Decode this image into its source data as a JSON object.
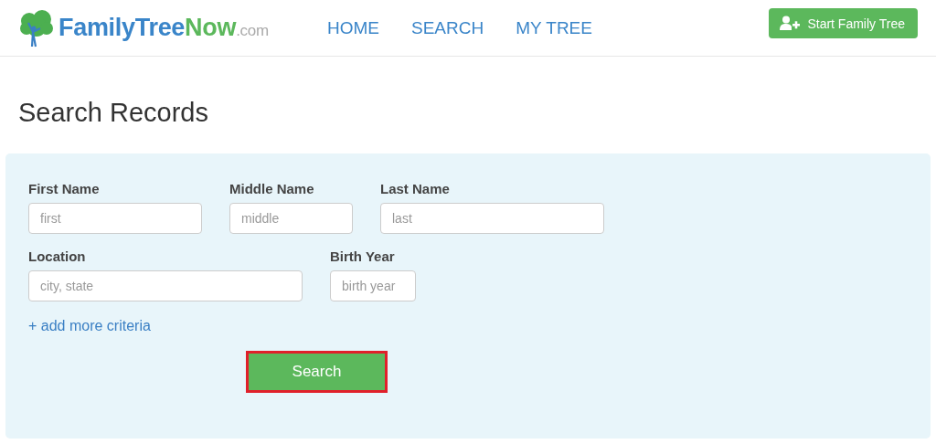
{
  "header": {
    "logo": {
      "name_part_1": "FamilyTree",
      "name_part_2": "Now",
      "domain": ".com"
    },
    "nav": [
      {
        "label": "HOME"
      },
      {
        "label": "SEARCH"
      },
      {
        "label": "MY TREE"
      }
    ],
    "action_button": {
      "label": "Start Family Tree"
    }
  },
  "page_title": "Search Records",
  "search_form": {
    "rows": [
      [
        {
          "label": "First Name",
          "placeholder": "first"
        },
        {
          "label": "Middle Name",
          "placeholder": "middle"
        },
        {
          "label": "Last Name",
          "placeholder": "last"
        }
      ],
      [
        {
          "label": "Location",
          "placeholder": "city, state"
        },
        {
          "label": "Birth Year",
          "placeholder": "birth year"
        }
      ]
    ],
    "more_link": "+ add more criteria",
    "submit": {
      "label": "Search",
      "highlighted": true
    }
  }
}
